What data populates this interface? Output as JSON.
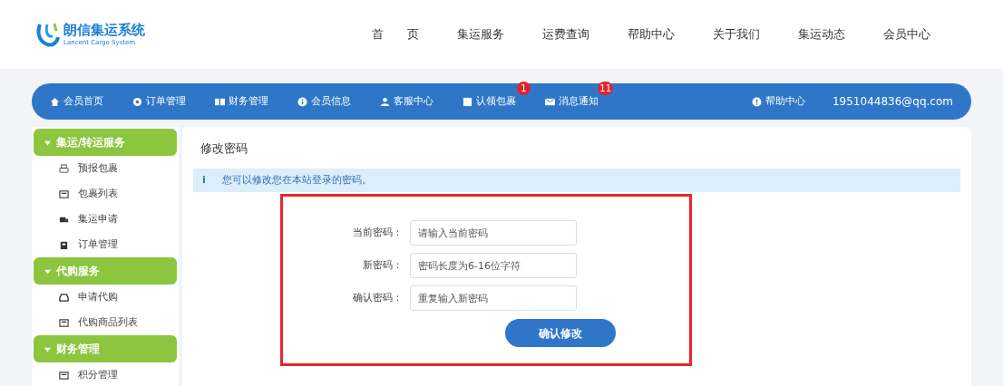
{
  "logo": {
    "title": "朗信集运系统",
    "subtitle": "Lancent Cargo System"
  },
  "top_nav": [
    {
      "label": "首　　页"
    },
    {
      "label": "集运服务"
    },
    {
      "label": "运费查询"
    },
    {
      "label": "帮助中心"
    },
    {
      "label": "关于我们"
    },
    {
      "label": "集运动态"
    },
    {
      "label": "会员中心"
    }
  ],
  "member_bar": {
    "items": [
      {
        "label": "会员首页"
      },
      {
        "label": "订单管理"
      },
      {
        "label": "财务管理"
      },
      {
        "label": "会员信息"
      },
      {
        "label": "客服中心"
      },
      {
        "label": "认领包裹",
        "badge": "1"
      },
      {
        "label": "消息通知",
        "badge": "11"
      }
    ],
    "help": {
      "label": "帮助中心"
    },
    "account": "1951044836@qq.com"
  },
  "sidebar": [
    {
      "title": "集运/转运服务",
      "expanded": true,
      "items": [
        {
          "label": "预报包裹"
        },
        {
          "label": "包裹列表"
        },
        {
          "label": "集运申请"
        },
        {
          "label": "订单管理"
        }
      ]
    },
    {
      "title": "代购服务",
      "expanded": true,
      "items": [
        {
          "label": "申请代购"
        },
        {
          "label": "代购商品列表"
        }
      ]
    },
    {
      "title": "财务管理",
      "expanded": true,
      "items": [
        {
          "label": "积分管理"
        }
      ]
    }
  ],
  "content": {
    "title": "修改密码",
    "notice_icon": "i",
    "notice": "您可以修改您在本站登录的密码。",
    "fields": [
      {
        "label": "当前密码：",
        "placeholder": "请输入当前密码"
      },
      {
        "label": "新密码：",
        "placeholder": "密码长度为6-16位字符"
      },
      {
        "label": "确认密码：",
        "placeholder": "重复输入新密码"
      }
    ],
    "submit": "确认修改"
  }
}
